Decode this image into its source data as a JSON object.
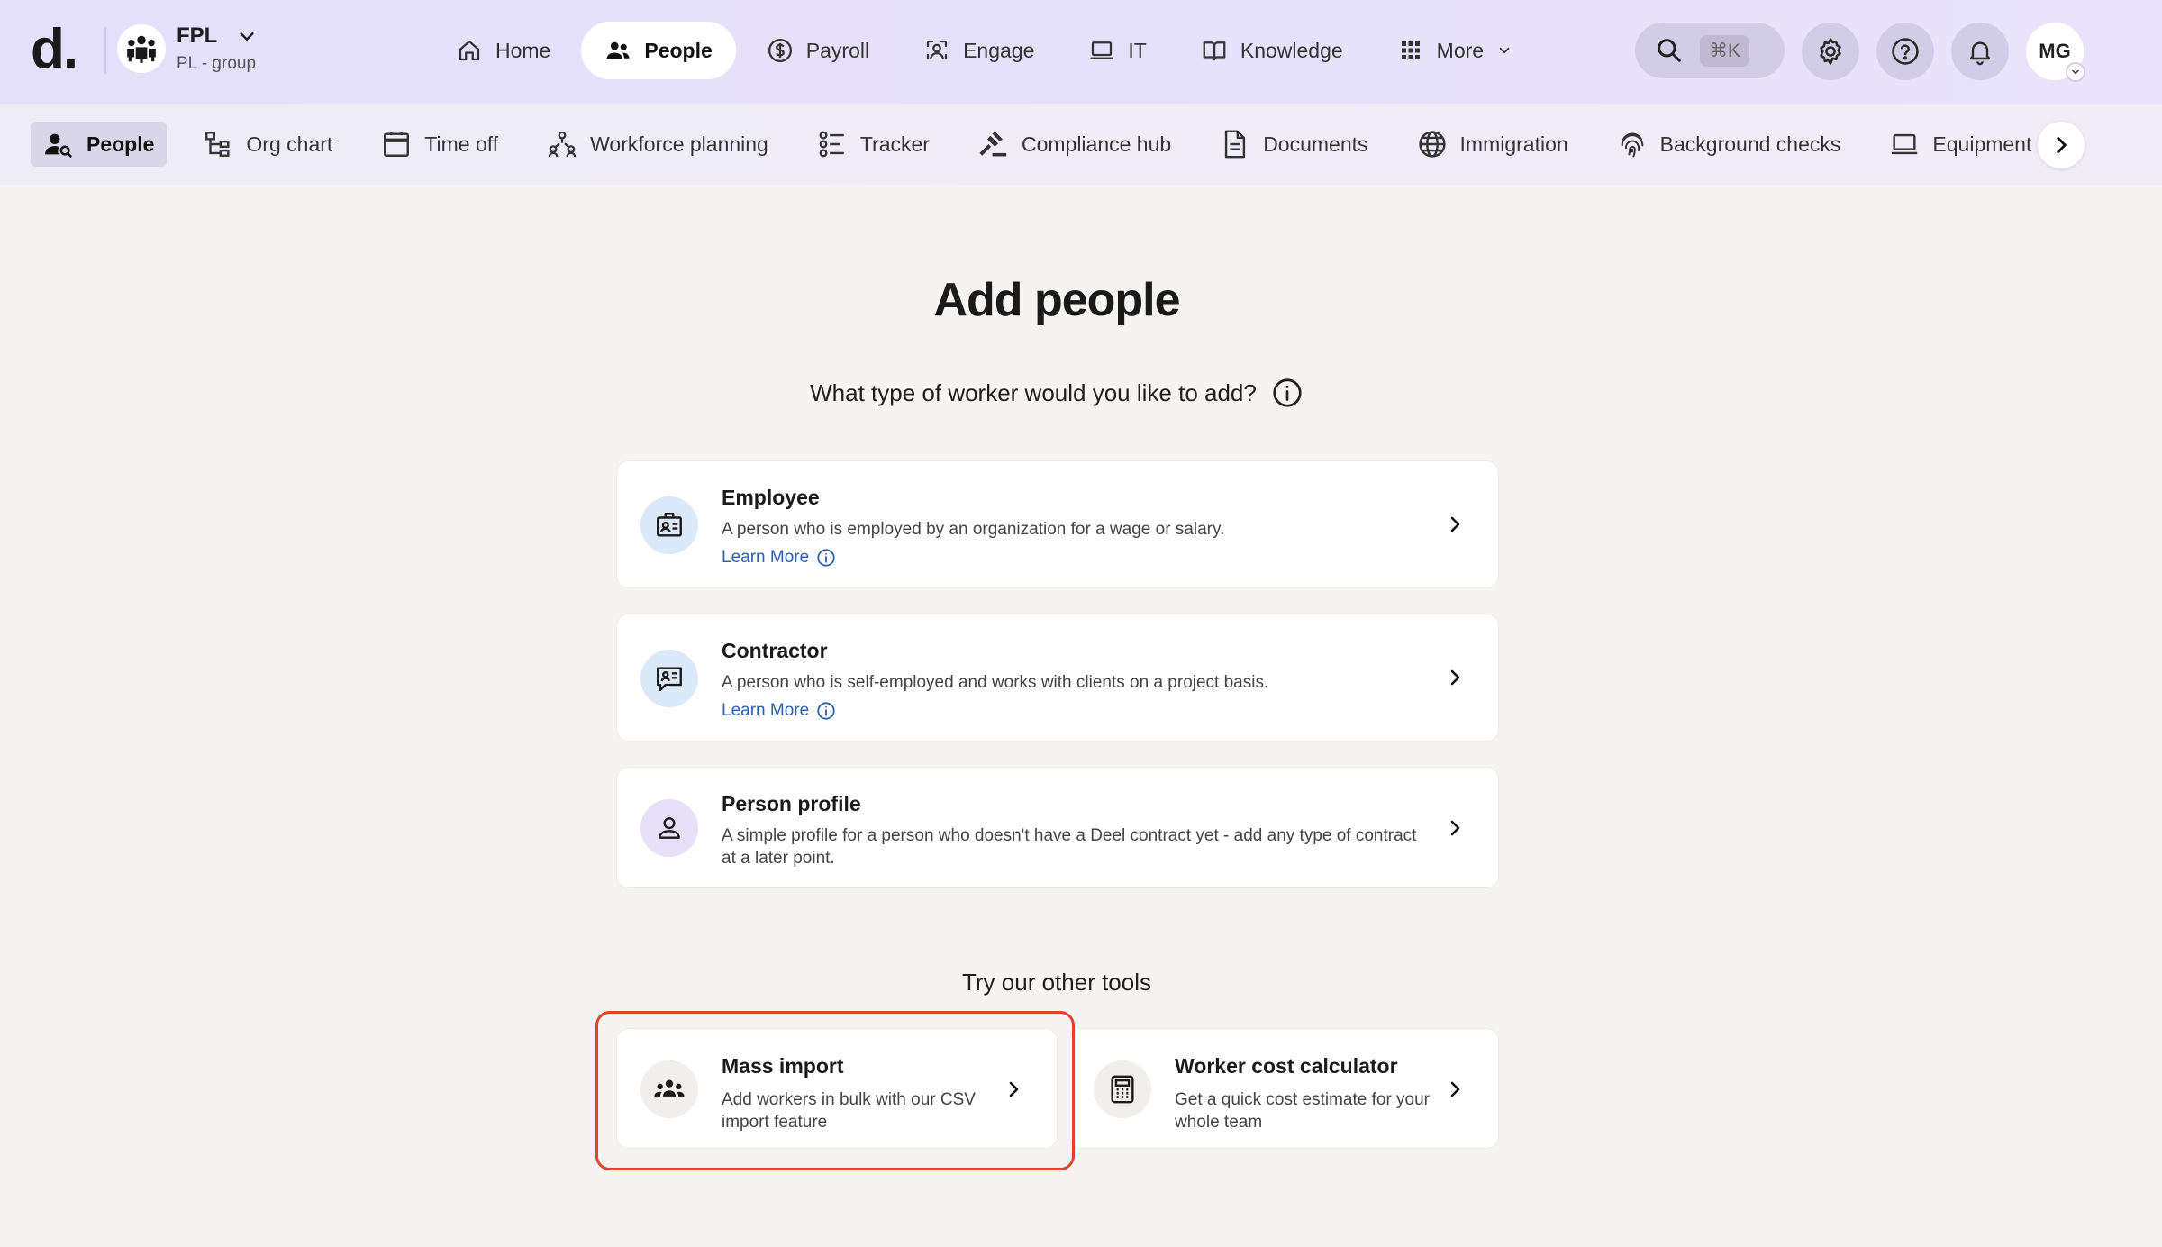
{
  "header": {
    "logo": "d.",
    "org": {
      "name": "FPL",
      "subtitle": "PL - group"
    },
    "nav": [
      {
        "label": "Home",
        "icon": "home-icon"
      },
      {
        "label": "People",
        "icon": "people-icon",
        "active": true
      },
      {
        "label": "Payroll",
        "icon": "dollar-icon"
      },
      {
        "label": "Engage",
        "icon": "engage-icon"
      },
      {
        "label": "IT",
        "icon": "laptop-icon"
      },
      {
        "label": "Knowledge",
        "icon": "book-icon"
      },
      {
        "label": "More",
        "icon": "grid-icon"
      }
    ],
    "search": {
      "shortcut": "⌘K"
    },
    "user": {
      "initials": "MG"
    }
  },
  "subnav": [
    {
      "label": "People",
      "icon": "person-search-icon",
      "active": true
    },
    {
      "label": "Org chart",
      "icon": "org-chart-icon"
    },
    {
      "label": "Time off",
      "icon": "calendar-icon"
    },
    {
      "label": "Workforce planning",
      "icon": "workforce-icon"
    },
    {
      "label": "Tracker",
      "icon": "tracker-icon"
    },
    {
      "label": "Compliance hub",
      "icon": "gavel-icon"
    },
    {
      "label": "Documents",
      "icon": "document-icon"
    },
    {
      "label": "Immigration",
      "icon": "globe-icon"
    },
    {
      "label": "Background checks",
      "icon": "fingerprint-icon"
    },
    {
      "label": "Equipment",
      "icon": "laptop-icon"
    }
  ],
  "main": {
    "title": "Add people",
    "question": "What type of worker would you like to add?",
    "cards": [
      {
        "title": "Employee",
        "description": "A person who is employed by an organization for a wage or salary.",
        "link": "Learn More",
        "icon": "id-badge-icon",
        "icon_bg": "#dce9fb"
      },
      {
        "title": "Contractor",
        "description": "A person who is self-employed and works with clients on a project basis.",
        "link": "Learn More",
        "icon": "contract-icon",
        "icon_bg": "#dce9fb"
      },
      {
        "title": "Person profile",
        "description": "A simple profile for a person who doesn't have a Deel contract yet - add any type of contract at a later point.",
        "icon": "person-icon",
        "icon_bg": "#e6e0f8"
      }
    ],
    "tools_title": "Try our other tools",
    "tools": [
      {
        "title": "Mass import",
        "description": "Add workers in bulk with our CSV import feature",
        "icon": "group-icon",
        "highlighted": true
      },
      {
        "title": "Worker cost calculator",
        "description": "Get a quick cost estimate for your whole team",
        "icon": "calculator-icon"
      }
    ]
  },
  "colors": {
    "header_bg": "#e4dffb",
    "subnav_bg": "#efecfa",
    "link": "#2b5fb0",
    "highlight": "#e0432e"
  }
}
